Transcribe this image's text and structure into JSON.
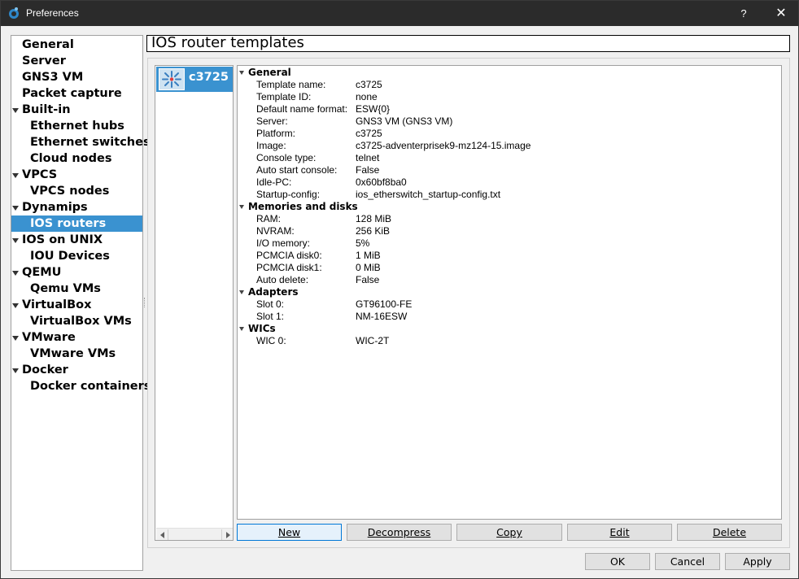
{
  "window": {
    "title": "Preferences",
    "help_label": "?",
    "close_label": "✕"
  },
  "sidebar": {
    "items": [
      {
        "label": "General",
        "level": 0,
        "expanded": false
      },
      {
        "label": "Server",
        "level": 0
      },
      {
        "label": "GNS3 VM",
        "level": 0
      },
      {
        "label": "Packet capture",
        "level": 0
      },
      {
        "label": "Built-in",
        "level": 0,
        "expanded": true
      },
      {
        "label": "Ethernet hubs",
        "level": 1
      },
      {
        "label": "Ethernet switches",
        "level": 1
      },
      {
        "label": "Cloud nodes",
        "level": 1
      },
      {
        "label": "VPCS",
        "level": 0,
        "expanded": true
      },
      {
        "label": "VPCS nodes",
        "level": 1
      },
      {
        "label": "Dynamips",
        "level": 0,
        "expanded": true
      },
      {
        "label": "IOS routers",
        "level": 1,
        "selected": true
      },
      {
        "label": "IOS on UNIX",
        "level": 0,
        "expanded": true
      },
      {
        "label": "IOU Devices",
        "level": 1
      },
      {
        "label": "QEMU",
        "level": 0,
        "expanded": true
      },
      {
        "label": "Qemu VMs",
        "level": 1
      },
      {
        "label": "VirtualBox",
        "level": 0,
        "expanded": true
      },
      {
        "label": "VirtualBox VMs",
        "level": 1
      },
      {
        "label": "VMware",
        "level": 0,
        "expanded": true
      },
      {
        "label": "VMware VMs",
        "level": 1
      },
      {
        "label": "Docker",
        "level": 0,
        "expanded": true
      },
      {
        "label": "Docker containers",
        "level": 1
      }
    ]
  },
  "page": {
    "title": "IOS router templates"
  },
  "templates": {
    "items": [
      {
        "name": "c3725",
        "icon": "router-icon",
        "selected": true
      }
    ]
  },
  "details": {
    "sections": [
      {
        "title": "General",
        "rows": [
          {
            "key": "Template name:",
            "value": "c3725"
          },
          {
            "key": "Template ID:",
            "value": "none"
          },
          {
            "key": "Default name format:",
            "value": "ESW{0}"
          },
          {
            "key": "Server:",
            "value": "GNS3 VM (GNS3 VM)"
          },
          {
            "key": "Platform:",
            "value": "c3725"
          },
          {
            "key": "Image:",
            "value": "c3725-adventerprisek9-mz124-15.image"
          },
          {
            "key": "Console type:",
            "value": "telnet"
          },
          {
            "key": "Auto start console:",
            "value": "False"
          },
          {
            "key": "Idle-PC:",
            "value": "0x60bf8ba0"
          },
          {
            "key": "Startup-config:",
            "value": "ios_etherswitch_startup-config.txt"
          }
        ]
      },
      {
        "title": "Memories and disks",
        "rows": [
          {
            "key": "RAM:",
            "value": "128 MiB"
          },
          {
            "key": "NVRAM:",
            "value": "256 KiB"
          },
          {
            "key": "I/O memory:",
            "value": "5%"
          },
          {
            "key": "PCMCIA disk0:",
            "value": "1 MiB"
          },
          {
            "key": "PCMCIA disk1:",
            "value": "0 MiB"
          },
          {
            "key": "Auto delete:",
            "value": "False"
          }
        ]
      },
      {
        "title": "Adapters",
        "rows": [
          {
            "key": "Slot 0:",
            "value": "GT96100-FE"
          },
          {
            "key": "Slot 1:",
            "value": "NM-16ESW"
          }
        ]
      },
      {
        "title": "WICs",
        "rows": [
          {
            "key": "WIC 0:",
            "value": "WIC-2T"
          }
        ]
      }
    ]
  },
  "actions": {
    "new": "New",
    "decompress": "Decompress",
    "copy": "Copy",
    "edit": "Edit",
    "delete": "Delete"
  },
  "dialog": {
    "ok": "OK",
    "cancel": "Cancel",
    "apply": "Apply"
  },
  "colors": {
    "selection": "#3a92d0",
    "titlebar": "#2b2b2b"
  }
}
